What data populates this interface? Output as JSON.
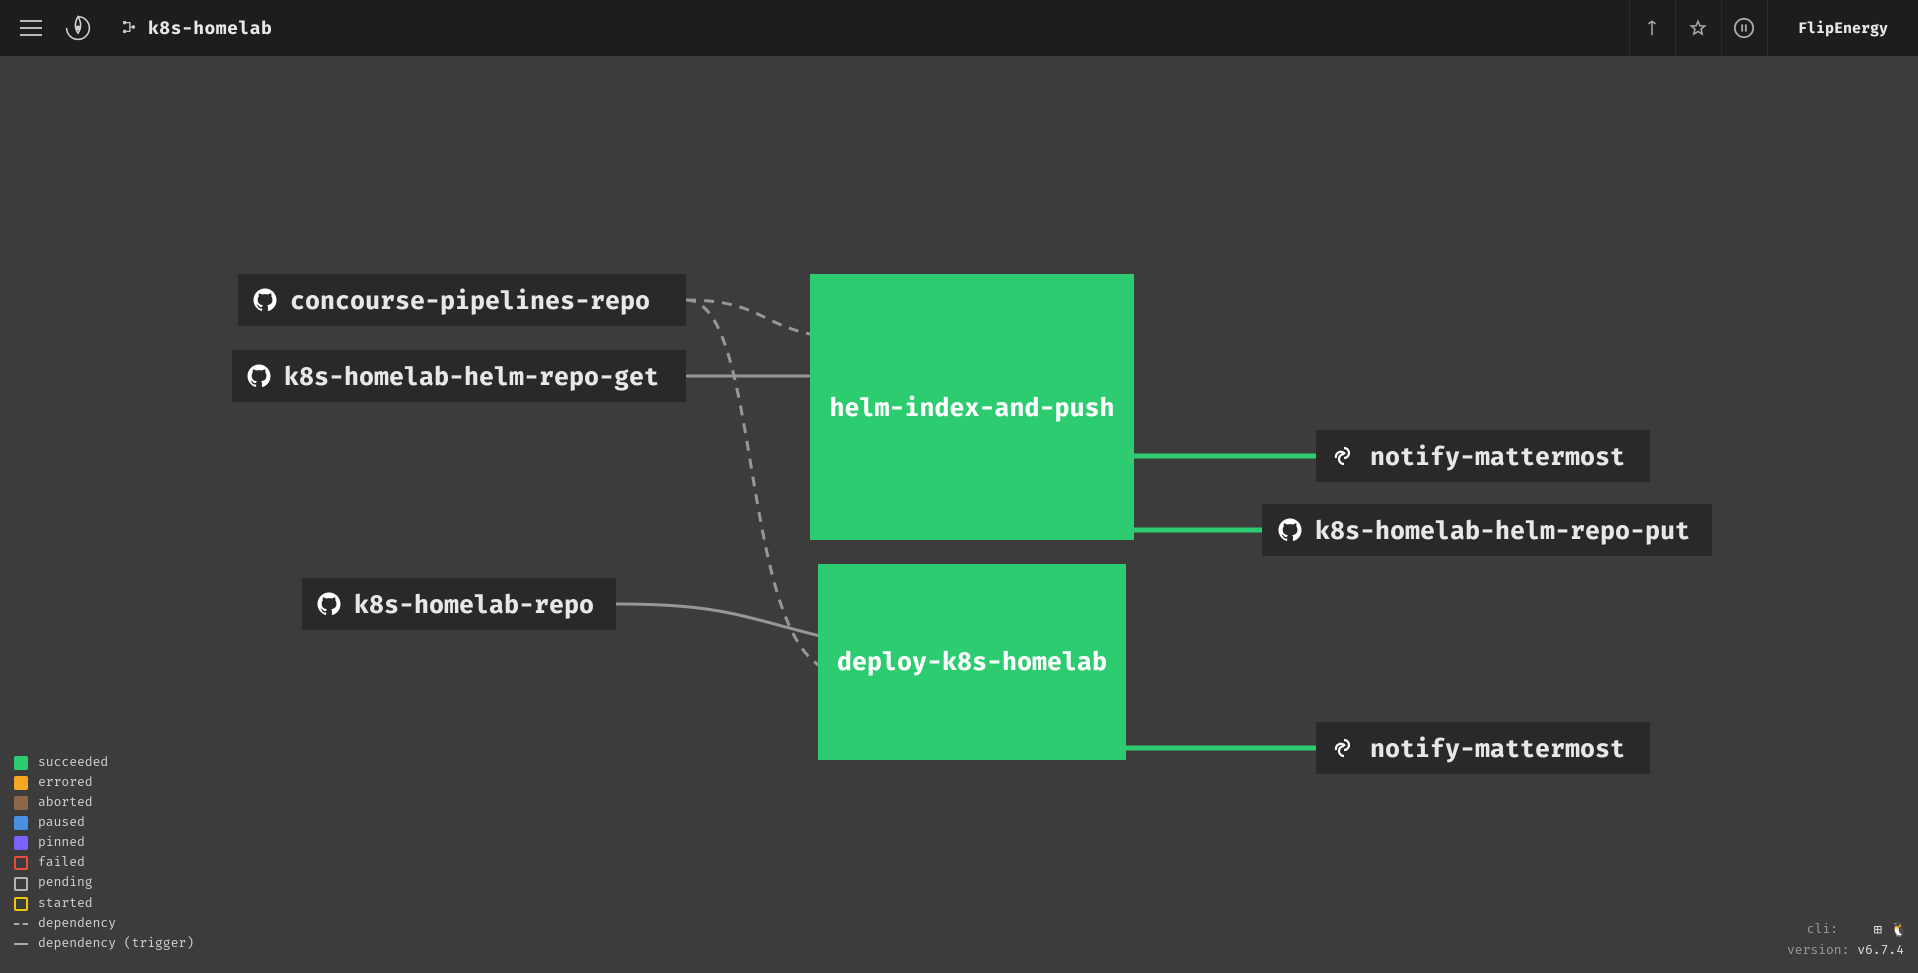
{
  "header": {
    "pipeline_name": "k8s-homelab",
    "user": "FlipEnergy"
  },
  "jobs": {
    "helm": "helm-index-and-push",
    "deploy": "deploy-k8s-homelab"
  },
  "resources": {
    "concourse_repo": "concourse-pipelines-repo",
    "helm_repo_get": "k8s-homelab-helm-repo-get",
    "homelab_repo": "k8s-homelab-repo",
    "notify1": "notify-mattermost",
    "helm_repo_put": "k8s-homelab-helm-repo-put",
    "notify2": "notify-mattermost"
  },
  "legend": {
    "succeeded": "succeeded",
    "errored": "errored",
    "aborted": "aborted",
    "paused": "paused",
    "pinned": "pinned",
    "failed": "failed",
    "pending": "pending",
    "started": "started",
    "dependency": "dependency",
    "dependency_trigger": "dependency (trigger)"
  },
  "footer": {
    "cli_label": "cli:",
    "version_label": "version:",
    "version": "v6.7.4"
  }
}
